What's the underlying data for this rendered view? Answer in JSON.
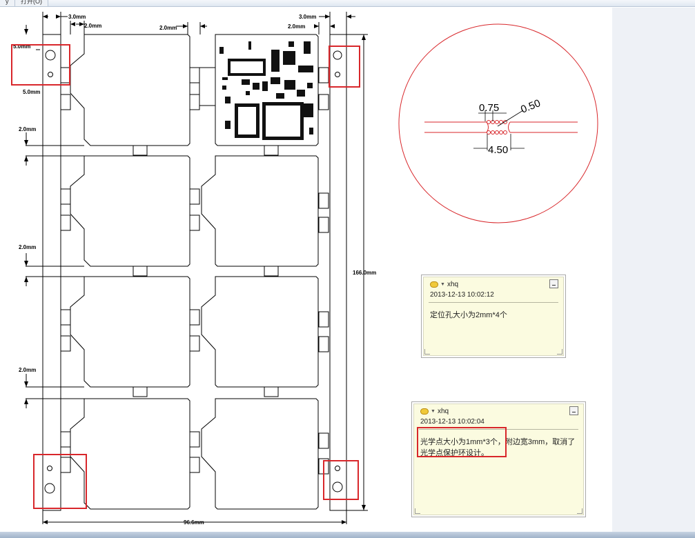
{
  "window": {
    "tabs": [
      "y",
      "打开(O)"
    ]
  },
  "drawing": {
    "dims": {
      "left_rail_width": "3.0mm",
      "left_gap": "2.0mm",
      "top_gap": "2.0mm",
      "right_rail_width": "3.0mm",
      "right_gap": "2.0mm",
      "hole_offset_top": "5.0mm",
      "hole_offset_bottom": "5.0mm",
      "row_gap_1": "2.0mm",
      "row_gap_2": "2.0mm",
      "row_gap_3": "2.0mm",
      "row_gap_4": "2.0mm",
      "total_height": "166.0mm",
      "total_width": "96.6mm"
    },
    "detail": {
      "pitch": "0.75",
      "hole": "0.50",
      "span": "4.50"
    }
  },
  "comments": [
    {
      "author": "xhq",
      "timestamp": "2013-12-13 10:02:12",
      "text": "定位孔大小为2mm*4个"
    },
    {
      "author": "xhq",
      "timestamp": "2013-12-13 10:02:04",
      "text": "光学点大小为1mm*3个，附边宽3mm，取消了光学点保护环设计。"
    }
  ],
  "colors": {
    "highlight": "#d8262a",
    "drawing_line": "#000000",
    "detail_line": "#d8262a",
    "note_background": "#fbfbe0"
  }
}
